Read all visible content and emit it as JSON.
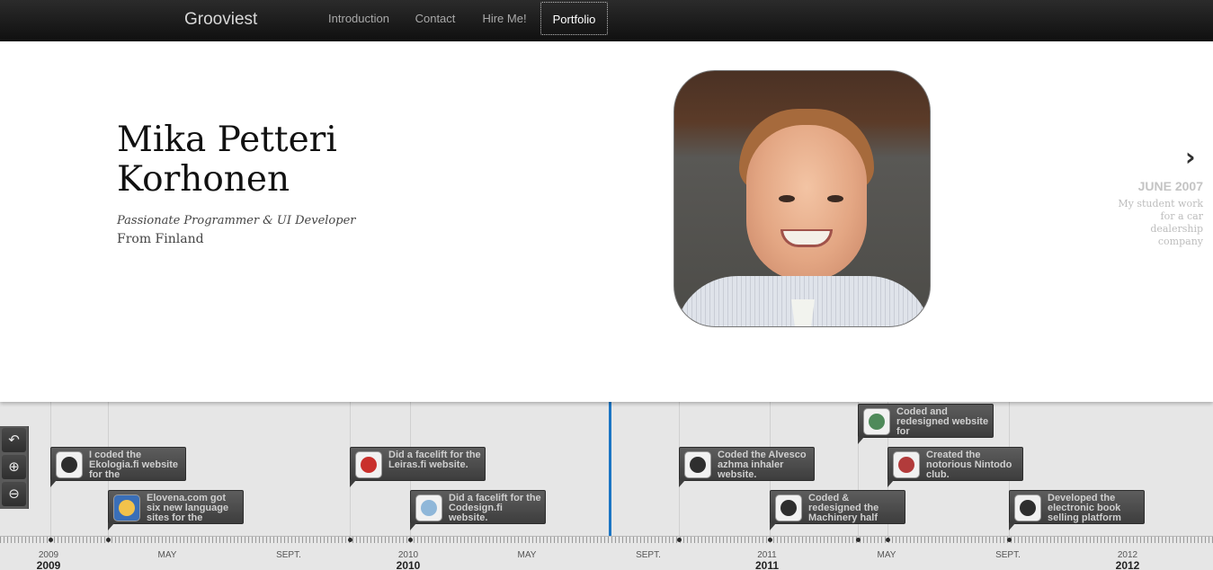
{
  "header": {
    "brand": "Grooviest",
    "nav": [
      {
        "label": "Introduction"
      },
      {
        "label": "Contact"
      },
      {
        "label": "Hire Me!"
      },
      {
        "label": "Portfolio",
        "active": true
      }
    ]
  },
  "profile": {
    "name": "Mika Petteri Korhonen",
    "tagline": "Passionate Programmer & UI Developer",
    "origin": "From Finland"
  },
  "next_slide": {
    "date": "JUNE 2007",
    "description": "My student work for a car dealership company"
  },
  "timeline": {
    "controls": [
      {
        "name": "back",
        "icon": "undo-icon",
        "glyph": "↶"
      },
      {
        "name": "zoom-in",
        "icon": "zoom-in-icon",
        "glyph": "⊕"
      },
      {
        "name": "zoom-out",
        "icon": "zoom-out-icon",
        "glyph": "⊖"
      }
    ],
    "events": [
      {
        "text": "I coded the Ekologia.fi website for the"
      },
      {
        "text": "Elovena.com got six new language sites for the"
      },
      {
        "text": "Did a facelift for the Leiras.fi website."
      },
      {
        "text": "Did a facelift for the Codesign.fi website."
      },
      {
        "text": "Coded the Alvesco azhma inhaler website."
      },
      {
        "text": "Coded & redesigned the Machinery half"
      },
      {
        "text": "Coded and redesigned website for"
      },
      {
        "text": "Created the notorious Nintodo club."
      },
      {
        "text": "Developed the electronic book selling platform"
      }
    ],
    "tick_labels": [
      "2009",
      "MAY",
      "SEPT.",
      "2010",
      "MAY",
      "SEPT.",
      "2011",
      "MAY",
      "SEPT.",
      "2012"
    ],
    "years": [
      "2009",
      "2010",
      "2011",
      "2012"
    ],
    "accent_color": "#1b75c4"
  }
}
